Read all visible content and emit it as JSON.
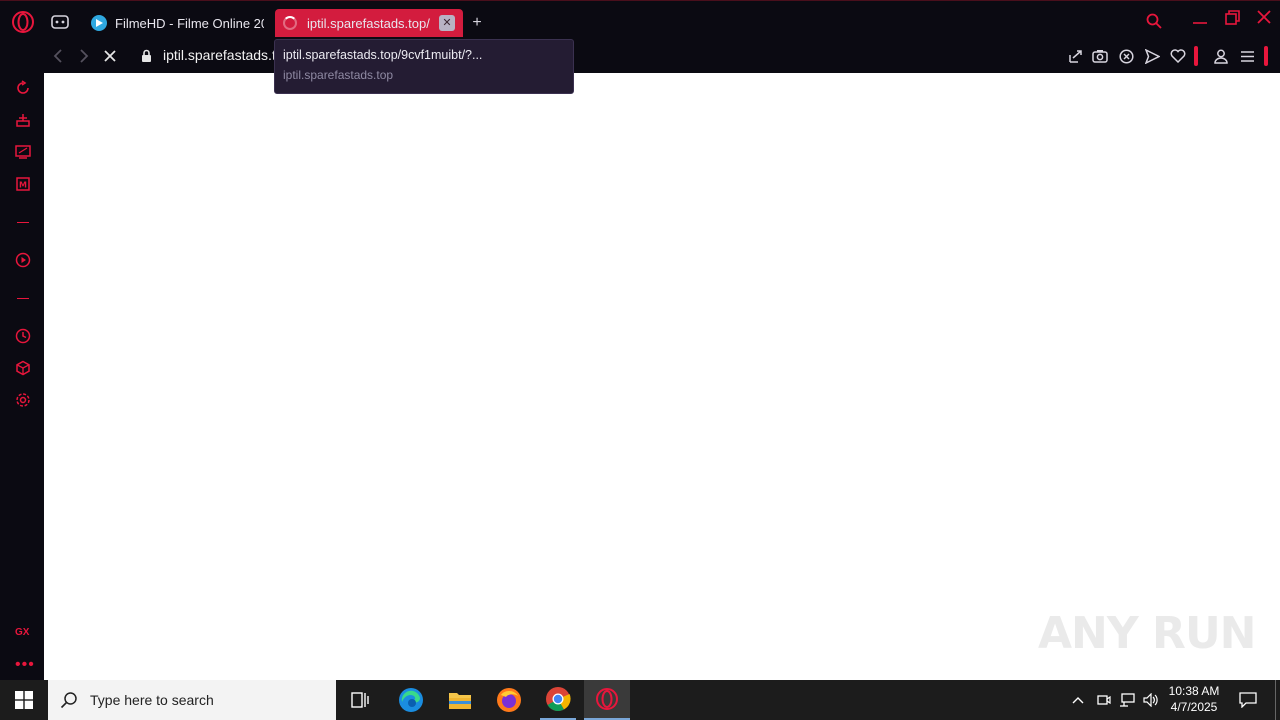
{
  "browser": {
    "accent_color": "#e8163c",
    "tabs": [
      {
        "label": "FilmeHD - Filme Online 20",
        "favicon": "play-circle-icon",
        "active": false
      },
      {
        "label": "iptil.sparefastads.top/",
        "favicon": "loading-spinner-icon",
        "active": true
      }
    ],
    "address": {
      "url": "iptil.sparefastads.t"
    },
    "tooltip": {
      "url": "iptil.sparefastads.top/9cvf1muibt/?...",
      "domain": "iptil.sparefastads.top"
    },
    "sidebar": {
      "badge": "GX"
    }
  },
  "watermark": "ANY RUN",
  "taskbar": {
    "search_placeholder": "Type here to search",
    "time": "10:38 AM",
    "date": "4/7/2025"
  }
}
